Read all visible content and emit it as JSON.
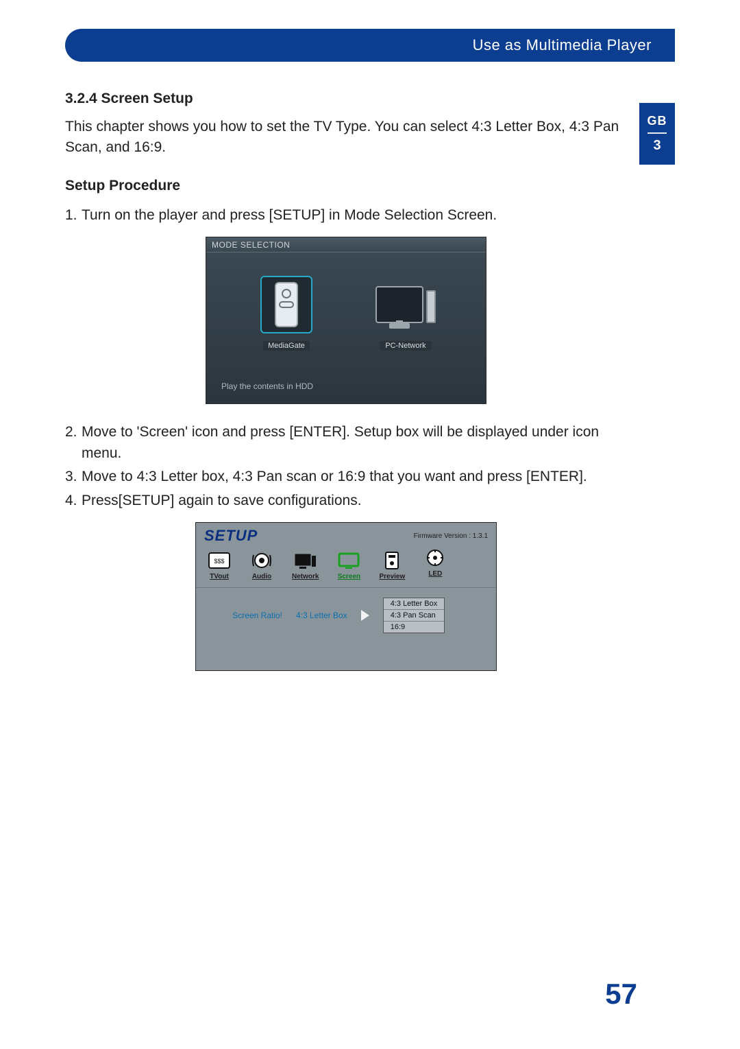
{
  "header": {
    "title": "Use as Multimedia Player"
  },
  "side_tab": {
    "lang": "GB",
    "chapter": "3"
  },
  "section": {
    "number_title": "3.2.4 Screen Setup",
    "intro": "This chapter shows you how to set the TV Type. You can select 4:3 Letter Box, 4:3 Pan Scan, and 16:9.",
    "procedure_heading": "Setup Procedure",
    "steps": [
      "Turn on the player and press [SETUP] in Mode Selection Screen.",
      "Move to 'Screen' icon and press [ENTER]. Setup box will be displayed under icon menu.",
      "Move to 4:3 Letter box, 4:3 Pan scan or 16:9 that you want and press [ENTER].",
      "Press[SETUP] again to save  configurations."
    ]
  },
  "figure1": {
    "title": "MODE SELECTION",
    "item_left": "MediaGate",
    "item_right": "PC-Network",
    "hint": "Play the contents in HDD"
  },
  "figure2": {
    "title": "SETUP",
    "firmware": "Firmware Version : 1.3.1",
    "categories": {
      "tvout": "TVout",
      "audio": "Audio",
      "network": "Network",
      "screen": "Screen",
      "preview": "Preview",
      "led": "LED"
    },
    "option_label": "Screen Ratio!",
    "option_value": "4:3 Letter Box",
    "dropdown": [
      "4:3 Letter Box",
      "4:3 Pan Scan",
      "16:9"
    ]
  },
  "page_number": "57"
}
